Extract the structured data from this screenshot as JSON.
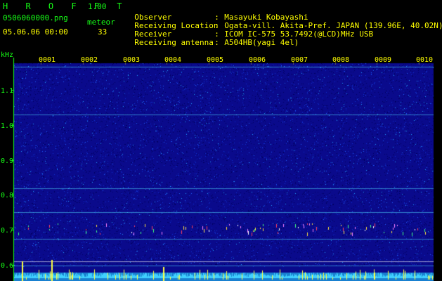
{
  "app": {
    "brand": "H R O F F T",
    "version": "1.00",
    "filename": "0506060000.png",
    "detector_label": "meteor",
    "datetime": "05.06.06 00:00",
    "count": "33"
  },
  "info": [
    {
      "label": "Observer",
      "value": "Masayuki Kobayashi"
    },
    {
      "label": "Receiving Location",
      "value": "Ogata-vill. Akita-Pref. JAPAN (139.96E, 40.02N)"
    },
    {
      "label": "Receiver",
      "value": "ICOM IC-575 53.7492(@LCD)MHz USB"
    },
    {
      "label": "Receiving antenna",
      "value": "A504HB(yagi 4el)"
    }
  ],
  "axis": {
    "unit": "kHz",
    "ticks": [
      "1.1",
      "1.0",
      "0.9",
      "0.8",
      "0.7",
      "0.6"
    ],
    "minute_labels": [
      "0001",
      "0002",
      "0003",
      "0004",
      "0005",
      "0006",
      "0007",
      "0008",
      "0009",
      "0010"
    ]
  },
  "colors": {
    "background": "#000000",
    "text_green": "#16ff16",
    "text_yellow": "#ffff00",
    "spectrogram_base": "#0a0a8c",
    "signal_line": "#00e0ff",
    "bottom_trace": "#40c0ff"
  }
}
